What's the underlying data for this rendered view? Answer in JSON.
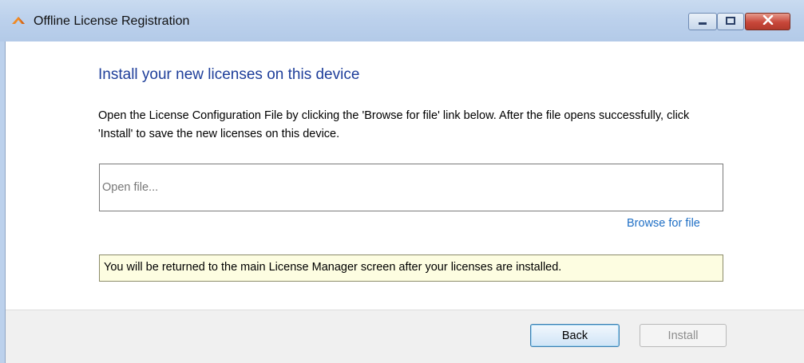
{
  "window": {
    "title": "Offline License Registration",
    "accent_color": "#1e3e9a",
    "link_color": "#1f6fc5"
  },
  "icons": {
    "app": "orange-arrow-logo-icon",
    "minimize": "minimize-icon",
    "maximize": "maximize-icon",
    "close": "close-icon"
  },
  "main": {
    "heading": "Install your new licenses on this device",
    "description": "Open the License Configuration File by clicking the 'Browse for file' link below. After the file opens successfully, click 'Install' to save the new licenses on this device.",
    "file_field": {
      "placeholder": "Open file...",
      "value": ""
    },
    "browse_link": "Browse for file",
    "info_note": "You will be returned to the main License Manager screen after your licenses are installed."
  },
  "footer": {
    "back_label": "Back",
    "install_label": "Install",
    "install_enabled": false
  }
}
